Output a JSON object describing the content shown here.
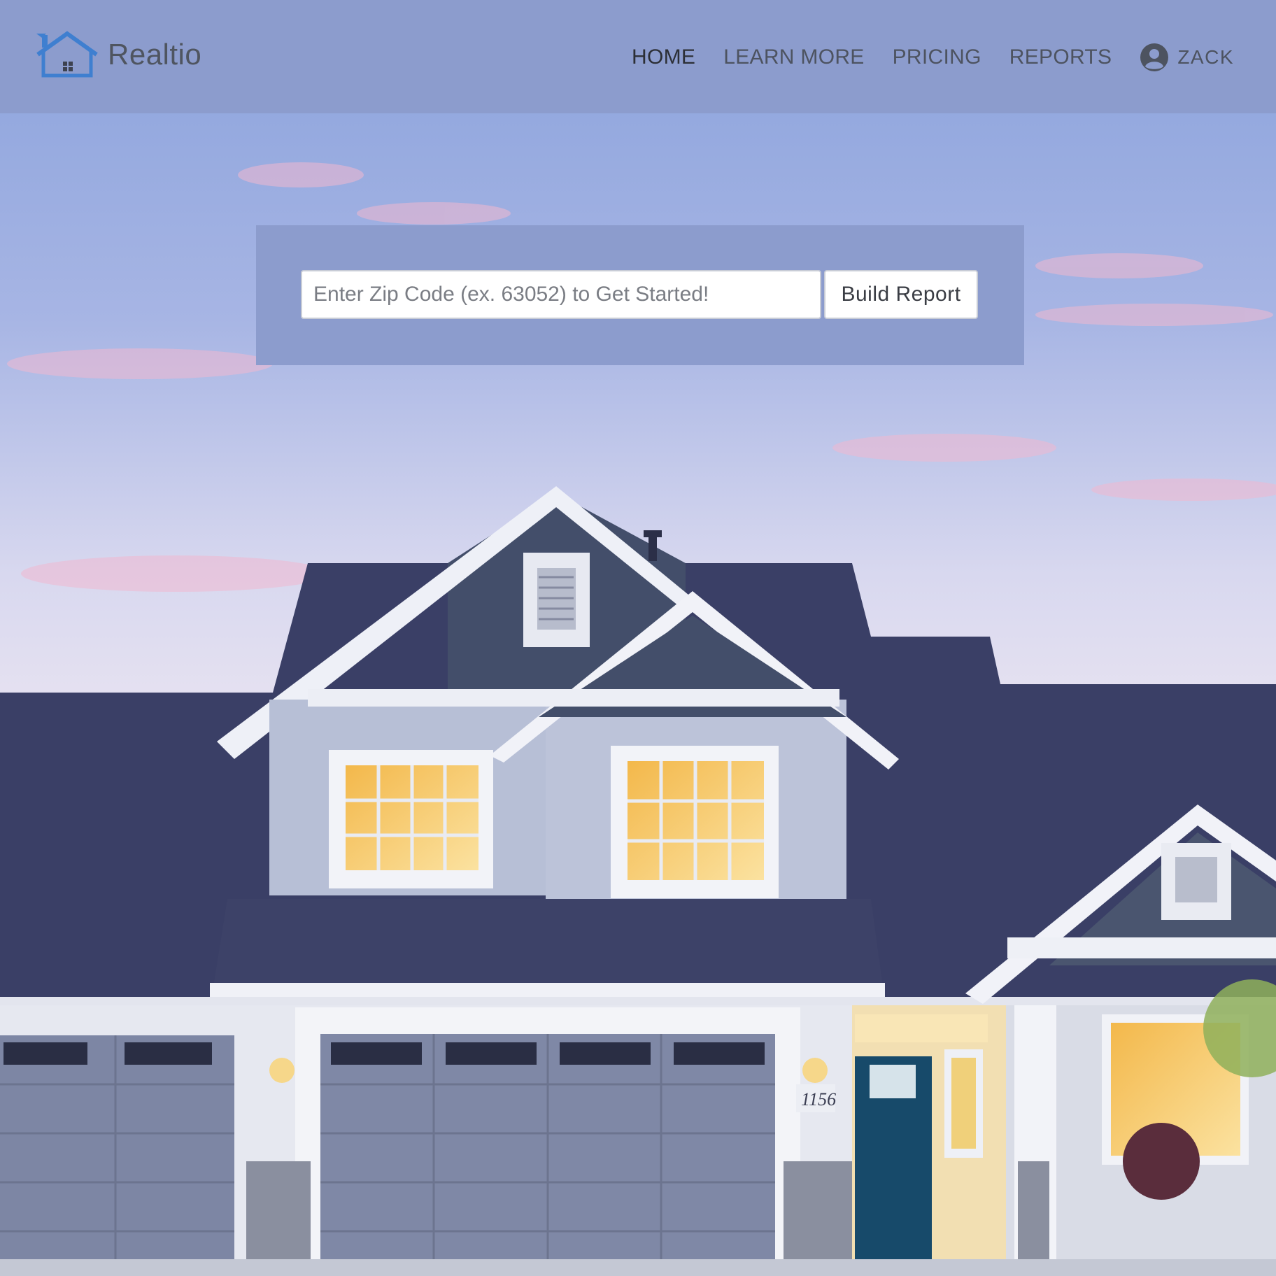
{
  "brand": {
    "name": "Realtio",
    "logo_icon": "house-icon",
    "logo_color": "#3f7fd0"
  },
  "nav": {
    "items": [
      {
        "label": "HOME",
        "active": true
      },
      {
        "label": "LEARN MORE",
        "active": false
      },
      {
        "label": "PRICING",
        "active": false
      },
      {
        "label": "REPORTS",
        "active": false
      }
    ],
    "user": {
      "icon": "user-circle-icon",
      "name": "ZACK"
    }
  },
  "search": {
    "placeholder": "Enter Zip Code (ex. 63052) to Get Started!",
    "value": "",
    "button_label": "Build Report"
  },
  "hero": {
    "image": "suburban-house-at-dusk",
    "house_number": "1156"
  },
  "colors": {
    "navbar_bg": "#8c9ccd",
    "panel_bg": "#8c9ccd",
    "nav_text": "#4d5360"
  }
}
